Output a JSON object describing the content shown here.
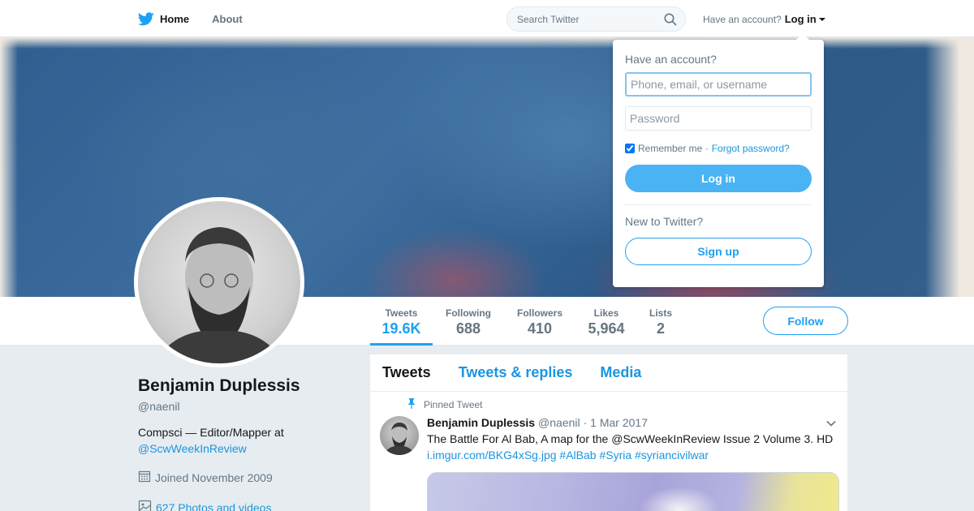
{
  "topnav": {
    "home_label": "Home",
    "about_label": "About",
    "search_placeholder": "Search Twitter",
    "account_prompt": "Have an account?",
    "login_label": "Log in"
  },
  "profile_stats": [
    {
      "label": "Tweets",
      "value": "19.6K"
    },
    {
      "label": "Following",
      "value": "688"
    },
    {
      "label": "Followers",
      "value": "410"
    },
    {
      "label": "Likes",
      "value": "5,964"
    },
    {
      "label": "Lists",
      "value": "2"
    }
  ],
  "follow_label": "Follow",
  "profile": {
    "name": "Benjamin Duplessis",
    "handle": "@naenil",
    "bio_text": "Compsci — Editor/Mapper at",
    "bio_link": "@ScwWeekInReview",
    "joined": "Joined November 2009",
    "photos": "627 Photos and videos"
  },
  "timeline": {
    "tabs": [
      "Tweets",
      "Tweets & replies",
      "Media"
    ],
    "pinned_label": "Pinned Tweet",
    "tweet": {
      "name": "Benjamin Duplessis",
      "handle": "@naenil",
      "date": "· 1 Mar 2017",
      "text": "The Battle For Al Bab, A map for the @ScwWeekInReview Issue 2 Volume 3. HD",
      "link": "i.imgur.com/BKG4xSg.jpg",
      "hashtags": "#AlBab #Syria #syriancivilwar"
    }
  },
  "login_dropdown": {
    "title": "Have an account?",
    "username_placeholder": "Phone, email, or username",
    "password_placeholder": "Password",
    "remember_label": "Remember me ·",
    "forgot_label": "Forgot password?",
    "login_button": "Log in",
    "new_prompt": "New to Twitter?",
    "signup_button": "Sign up"
  },
  "colors": {
    "accent": "#1da1f2",
    "link": "#1b95e0",
    "background": "#e6ecf0"
  }
}
